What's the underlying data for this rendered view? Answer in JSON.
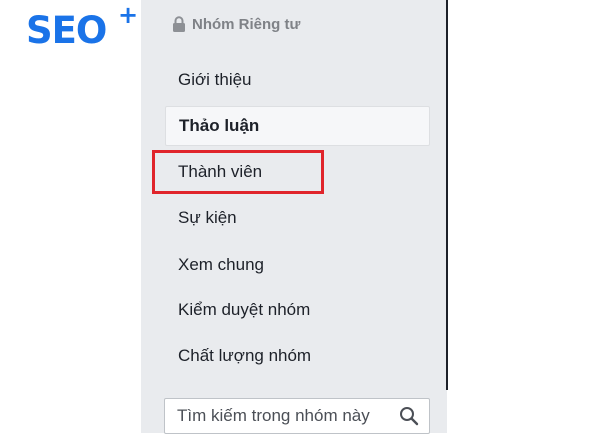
{
  "logo": {
    "text": "SEO",
    "superscript": "+"
  },
  "group": {
    "privacy_label": "Nhóm Riêng tư",
    "privacy_icon": "lock-icon"
  },
  "nav": {
    "items": [
      {
        "label": "Giới thiệu",
        "active": false
      },
      {
        "label": "Thảo luận",
        "active": true
      },
      {
        "label": "Thành viên",
        "active": false,
        "highlighted": true
      },
      {
        "label": "Sự kiện",
        "active": false
      },
      {
        "label": "Xem chung",
        "active": false
      },
      {
        "label": "Kiểm duyệt nhóm",
        "active": false
      },
      {
        "label": "Chất lượng nhóm",
        "active": false
      }
    ]
  },
  "search": {
    "placeholder": "Tìm kiếm trong nhóm này",
    "icon": "search-icon"
  },
  "colors": {
    "brand_blue": "#1a73e8",
    "panel_bg": "#e9ebee",
    "highlight_red": "#e0242b",
    "text": "#1d2129",
    "muted_text": "#7f8287"
  }
}
